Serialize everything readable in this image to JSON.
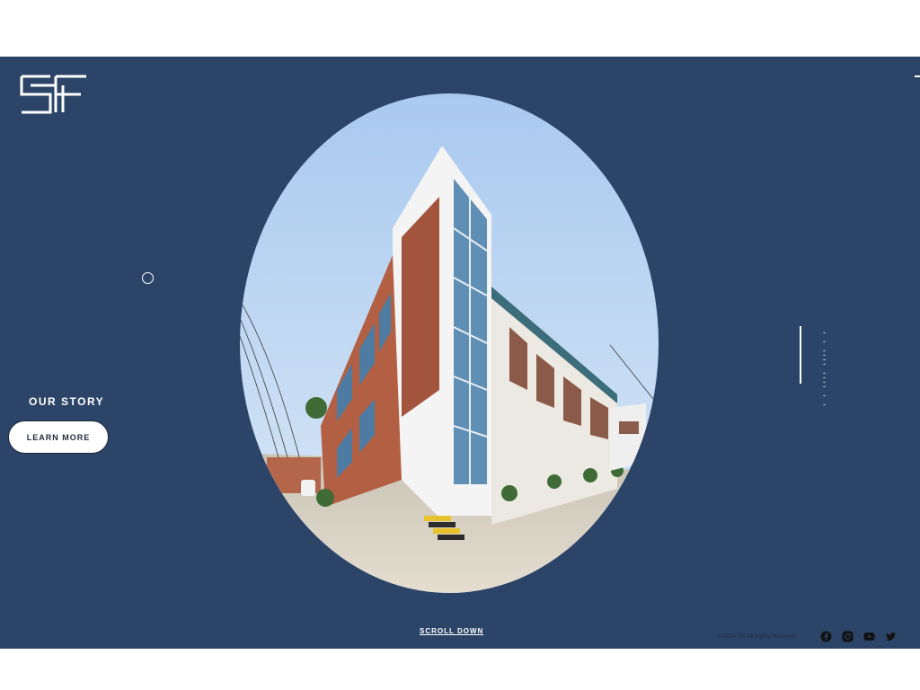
{
  "brand": {
    "logo_text": "SF",
    "logo_icon": "sf-monogram-logo"
  },
  "hero": {
    "section_label": "OUR STORY",
    "cta_label": "LEARN MORE",
    "image_alt": "Multi-storey brick and glass factory building",
    "scroll_label": "SCROLL DOWN"
  },
  "slider": {
    "dots": [
      "----",
      "----",
      "----"
    ]
  },
  "footer": {
    "copyright": "© 2024, SF. All Rights Reserved.",
    "socials": [
      {
        "name": "facebook-icon"
      },
      {
        "name": "instagram-icon"
      },
      {
        "name": "youtube-icon"
      },
      {
        "name": "twitter-icon"
      }
    ]
  },
  "colors": {
    "background": "#2c4467",
    "accent": "#ffffff",
    "text_dark": "#1d2b3e"
  }
}
